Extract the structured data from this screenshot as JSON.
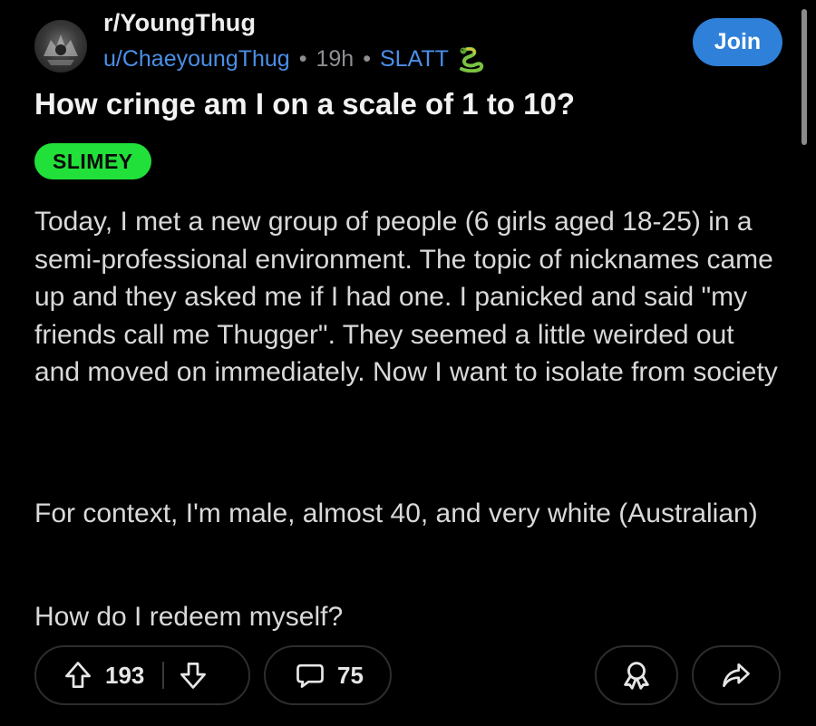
{
  "post_header": {
    "subreddit": "r/YoungThug",
    "username": "u/ChaeyoungThug",
    "separator": "•",
    "age": "19h",
    "user_flair": "SLATT",
    "user_flair_icon": "snake-icon",
    "join_label": "Join"
  },
  "post": {
    "title": "How cringe am I on a scale of 1 to 10?",
    "flair": "SLIMEY",
    "flair_color": "#22e03a",
    "paragraphs": [
      "Today, I met a new group of people (6 girls aged 18-25) in a semi-professional environment. The topic of nicknames came up and they asked me if I had one. I panicked and said \"my friends call me Thugger\". They seemed a little weirded out and moved on immediately. Now I want to isolate from society",
      "For context, I'm male, almost 40, and very white (Australian)",
      "How do I redeem myself?"
    ]
  },
  "actions": {
    "upvotes": "193",
    "comments": "75",
    "icons": [
      "upvote-icon",
      "downvote-icon",
      "comment-icon",
      "award-icon",
      "share-icon"
    ]
  },
  "colors": {
    "background": "#000000",
    "link_blue": "#4a8fe7",
    "join_button": "#2f80d8",
    "flair_green": "#22e03a"
  }
}
